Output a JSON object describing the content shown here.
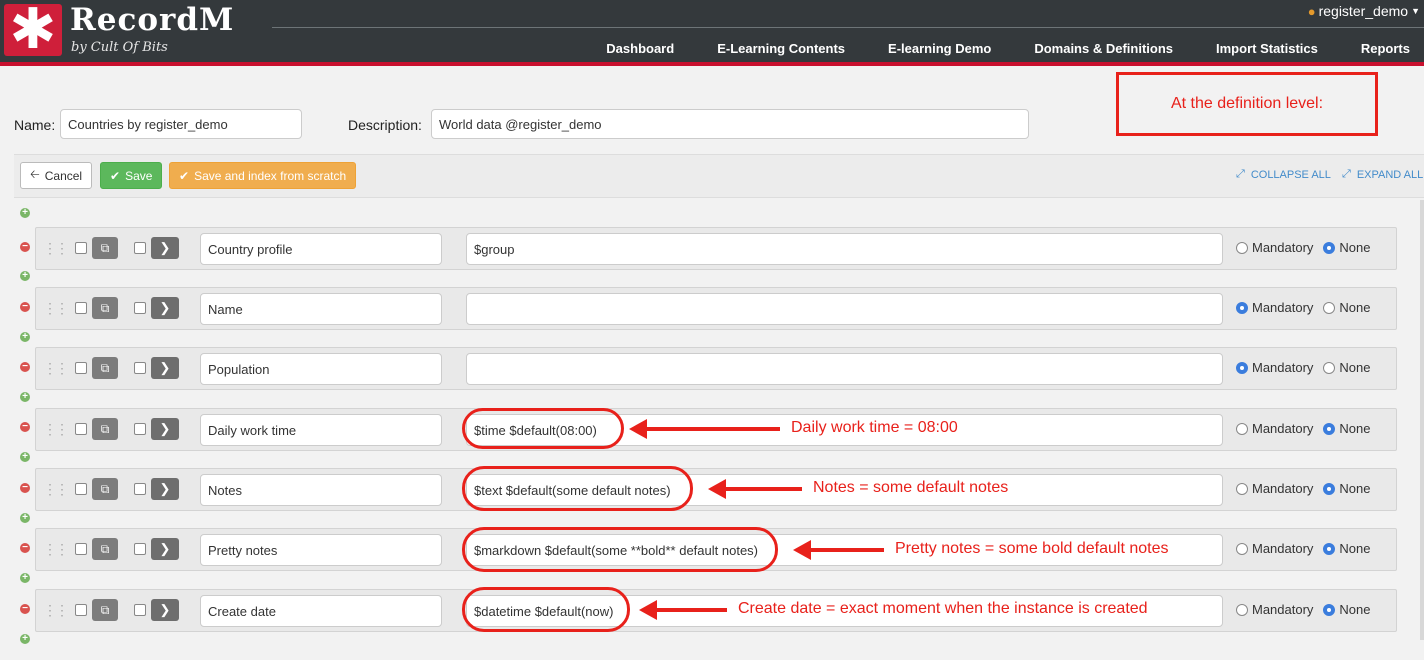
{
  "app": {
    "name": "RecordM",
    "subtitle": "by Cult Of Bits",
    "logo_symbol": "✱"
  },
  "user": {
    "name": "register_demo"
  },
  "nav": [
    "Dashboard",
    "E-Learning Contents",
    "E-learning Demo",
    "Domains & Definitions",
    "Import Statistics",
    "Reports"
  ],
  "form": {
    "name_label": "Name:",
    "name_value": "Countries by register_demo",
    "description_label": "Description:",
    "description_value": "World data @register_demo"
  },
  "callout": "At the definition level:",
  "toolbar": {
    "cancel": "Cancel",
    "save": "Save",
    "save_index": "Save and index from scratch",
    "collapse": "COLLAPSE ALL",
    "expand": "EXPAND ALL"
  },
  "radio_labels": {
    "mandatory": "Mandatory",
    "none": "None"
  },
  "fields": [
    {
      "name": "Country profile",
      "description": "$group",
      "selected": "none"
    },
    {
      "name": "Name",
      "description": "",
      "selected": "mandatory"
    },
    {
      "name": "Population",
      "description": "",
      "selected": "mandatory"
    },
    {
      "name": "Daily work time",
      "description": "$time $default(08:00)",
      "selected": "none"
    },
    {
      "name": "Notes",
      "description": "$text $default(some default notes)",
      "selected": "none"
    },
    {
      "name": "Pretty notes",
      "description": "$markdown $default(some **bold** default notes)",
      "selected": "none"
    },
    {
      "name": "Create date",
      "description": "$datetime $default(now)",
      "selected": "none"
    }
  ],
  "annotations": [
    "Daily work time = 08:00",
    "Notes = some default notes",
    "Pretty notes = some bold default notes",
    "Create date = exact moment when the instance is created"
  ],
  "colors": {
    "header": "#34393c",
    "brand_red": "#cf1f3a",
    "annotation_red": "#e8211b",
    "save_green": "#5cb85c",
    "index_orange": "#f0ad4e"
  }
}
